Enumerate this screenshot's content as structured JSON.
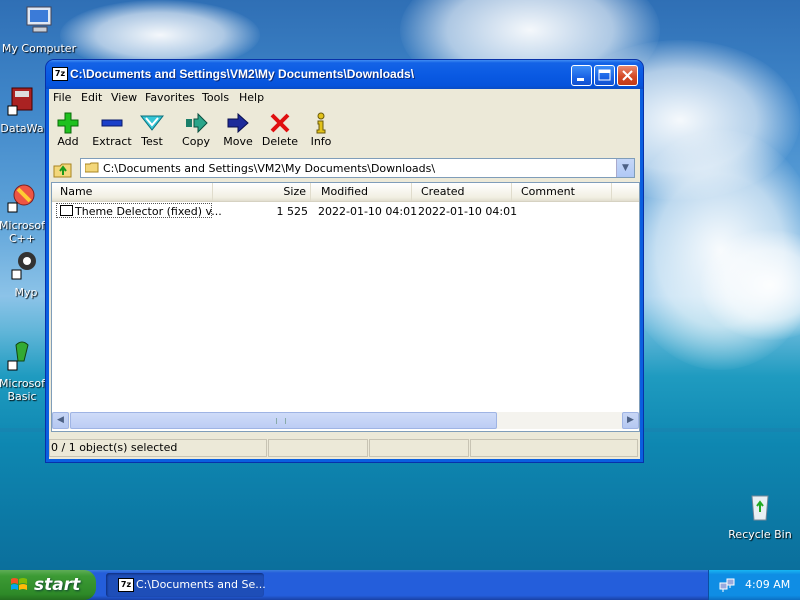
{
  "desktop": {
    "icons": [
      {
        "label": "My Computer"
      },
      {
        "label": "DataWa"
      },
      {
        "label": "Microsof\nC++"
      },
      {
        "label": "Myp"
      },
      {
        "label": "Microsof\nBasic"
      },
      {
        "label": "Recycle Bin"
      }
    ]
  },
  "window": {
    "title": "C:\\Documents and Settings\\VM2\\My Documents\\Downloads\\",
    "app_icon_text": "7z",
    "menu": [
      "File",
      "Edit",
      "View",
      "Favorites",
      "Tools",
      "Help"
    ],
    "toolbar": [
      {
        "label": "Add",
        "icon": "add-icon"
      },
      {
        "label": "Extract",
        "icon": "extract-icon"
      },
      {
        "label": "Test",
        "icon": "test-icon"
      },
      {
        "label": "Copy",
        "icon": "copy-icon"
      },
      {
        "label": "Move",
        "icon": "move-icon"
      },
      {
        "label": "Delete",
        "icon": "delete-icon"
      },
      {
        "label": "Info",
        "icon": "info-icon"
      }
    ],
    "address": "C:\\Documents and Settings\\VM2\\My Documents\\Downloads\\",
    "columns": [
      "Name",
      "Size",
      "Modified",
      "Created",
      "Comment"
    ],
    "files": [
      {
        "name": "Theme Delector (fixed) v...",
        "size": "1 525",
        "modified": "2022-01-10 04:01",
        "created": "2022-01-10 04:01",
        "comment": ""
      }
    ],
    "status": {
      "selected": "0 / 1 object(s) selected"
    }
  },
  "taskbar": {
    "start_label": "start",
    "task_button": "C:\\Documents and Se...",
    "clock": "4:09 AM"
  },
  "colors": {
    "titlebar": "#0a5ae3",
    "start": "#3c9a34",
    "taskbar": "#245edb"
  }
}
